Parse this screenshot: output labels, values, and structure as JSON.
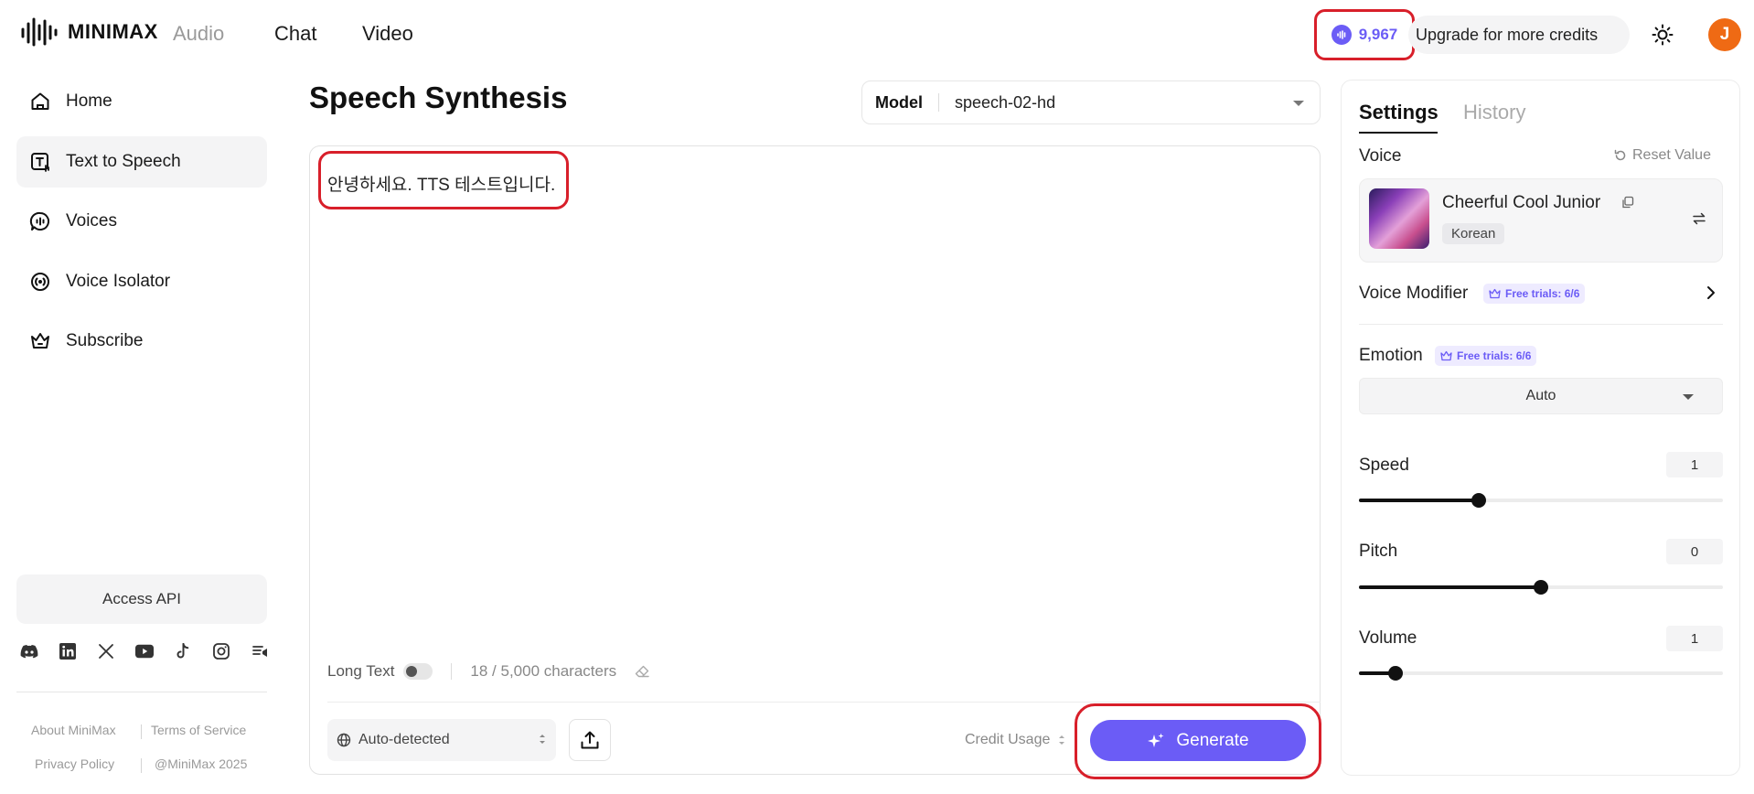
{
  "header": {
    "logo_text": "MINIMAX",
    "nav": {
      "audio": "Audio",
      "chat": "Chat",
      "video": "Video"
    },
    "credits": "9,967",
    "upgrade": "Upgrade for more credits",
    "avatar_initial": "J",
    "accent_color": "#6b5cf6"
  },
  "sidebar": {
    "items": [
      {
        "label": "Home",
        "icon": "home-icon"
      },
      {
        "label": "Text to Speech",
        "icon": "text-to-speech-icon",
        "active": true
      },
      {
        "label": "Voices",
        "icon": "voices-icon"
      },
      {
        "label": "Voice Isolator",
        "icon": "voice-isolator-icon"
      },
      {
        "label": "Subscribe",
        "icon": "crown-icon"
      }
    ],
    "access_api": "Access API",
    "socials": [
      "discord-icon",
      "linkedin-icon",
      "x-icon",
      "youtube-icon",
      "tiktok-icon",
      "instagram-icon",
      "news-icon"
    ],
    "footer": {
      "about": "About MiniMax",
      "terms": "Terms of Service",
      "privacy": "Privacy Policy",
      "copyright": "@MiniMax 2025"
    }
  },
  "main": {
    "title": "Speech Synthesis",
    "model": {
      "label": "Model",
      "value": "speech-02-hd"
    },
    "text": "안녕하세요. TTS 테스트입니다.",
    "long_text_label": "Long Text",
    "char_count": "18 / 5,000 characters",
    "language": "Auto-detected",
    "credit_usage": "Credit Usage",
    "generate": "Generate"
  },
  "panel": {
    "tabs": {
      "settings": "Settings",
      "history": "History"
    },
    "voice": {
      "label": "Voice",
      "reset": "Reset Value",
      "name": "Cheerful Cool Junior",
      "language": "Korean"
    },
    "voice_modifier": {
      "label": "Voice Modifier",
      "badge": "Free trials: 6/6"
    },
    "emotion": {
      "label": "Emotion",
      "badge": "Free trials: 6/6",
      "value": "Auto"
    },
    "speed": {
      "label": "Speed",
      "value": "1",
      "fraction": 0.33
    },
    "pitch": {
      "label": "Pitch",
      "value": "0",
      "fraction": 0.5
    },
    "volume": {
      "label": "Volume",
      "value": "1",
      "fraction": 0.1
    }
  }
}
